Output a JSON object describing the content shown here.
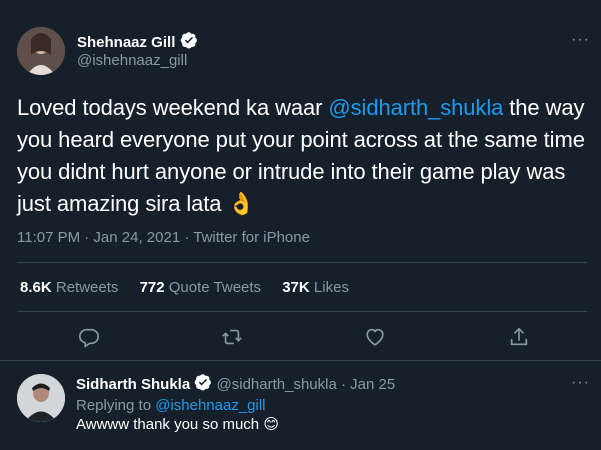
{
  "tweet": {
    "author_name": "Shehnaaz Gill",
    "author_handle": "@ishehnaaz_gill",
    "text_part1": "Loved todays weekend ka waar ",
    "mention": "@sidharth_shukla",
    "text_part2": " the way you heard everyone put your point across at the same time you didnt hurt anyone or intrude into their game play was just amazing sira lata ",
    "emoji": "👌",
    "timestamp": "11:07 PM · Jan 24, 2021",
    "separator": " · ",
    "source": "Twitter for iPhone",
    "more": "···"
  },
  "stats": {
    "retweets_count": "8.6K",
    "retweets_label": "Retweets",
    "quotes_count": "772",
    "quotes_label": "Quote Tweets",
    "likes_count": "37K",
    "likes_label": "Likes"
  },
  "reply": {
    "author_name": "Sidharth Shukla",
    "author_handle": "@sidharth_shukla",
    "date": "Jan 25",
    "dot": "·",
    "replying_to_label": "Replying to ",
    "replying_to_handle": "@ishehnaaz_gill",
    "text": "Awwww thank you so much ",
    "emoji": "😊",
    "more": "···"
  },
  "colors": {
    "background": "#15202b",
    "accent": "#1d9bf0",
    "muted": "#8b98a5",
    "divider": "#38444d"
  },
  "icons": [
    "verified-badge-icon",
    "reply-icon",
    "retweet-icon",
    "like-icon",
    "share-icon",
    "more-icon"
  ]
}
